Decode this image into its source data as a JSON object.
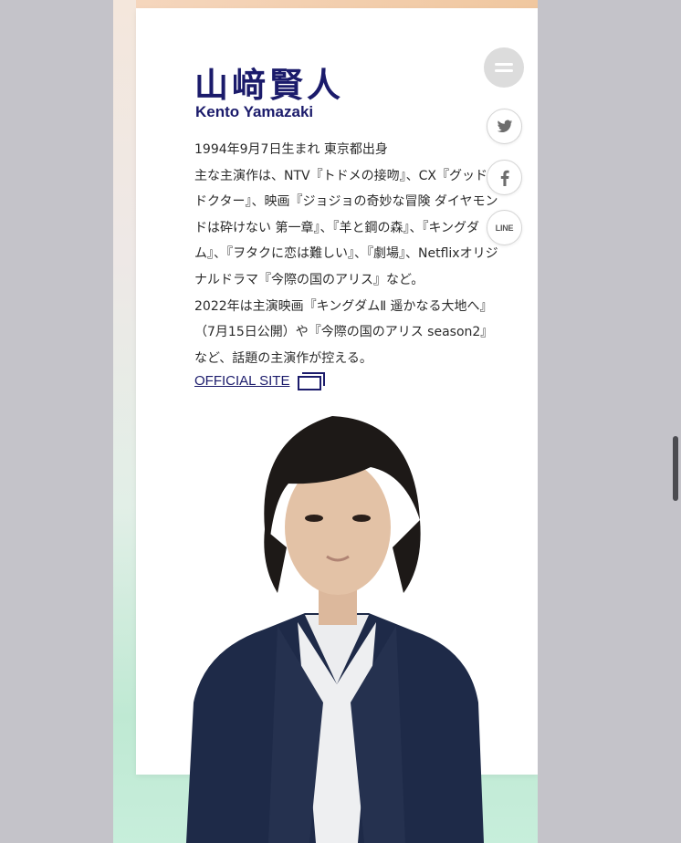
{
  "profile": {
    "name_jp": "山﨑賢人",
    "name_en": "Kento Yamazaki",
    "bio_lines": [
      "1994年9月7日生まれ 東京都出身",
      "主な主演作は、NTV『トドメの接吻』、CX『グッド・ドクター』、映画『ジョジョの奇妙な冒険 ダイヤモンドは砕けない 第一章』、『羊と鋼の森』、『キングダム』、『ヲタクに恋は難しい』、『劇場』、Netflixオリジナルドラマ『今際の国のアリス』など。",
      "2022年は主演映画『キングダムⅡ 遥かなる大地へ』（7月15日公開）や『今際の国のアリス season2』など、話題の主演作が控える。"
    ],
    "official_site_label": "OFFICIAL SITE"
  },
  "share": {
    "menu_icon": "menu-icon",
    "twitter_icon": "twitter-icon",
    "facebook_icon": "facebook-icon",
    "line_label": "LINE"
  },
  "colors": {
    "accent": "#1b1b6b",
    "backdrop": "#c4c3c9",
    "menu_button": "#dcdcdc"
  }
}
